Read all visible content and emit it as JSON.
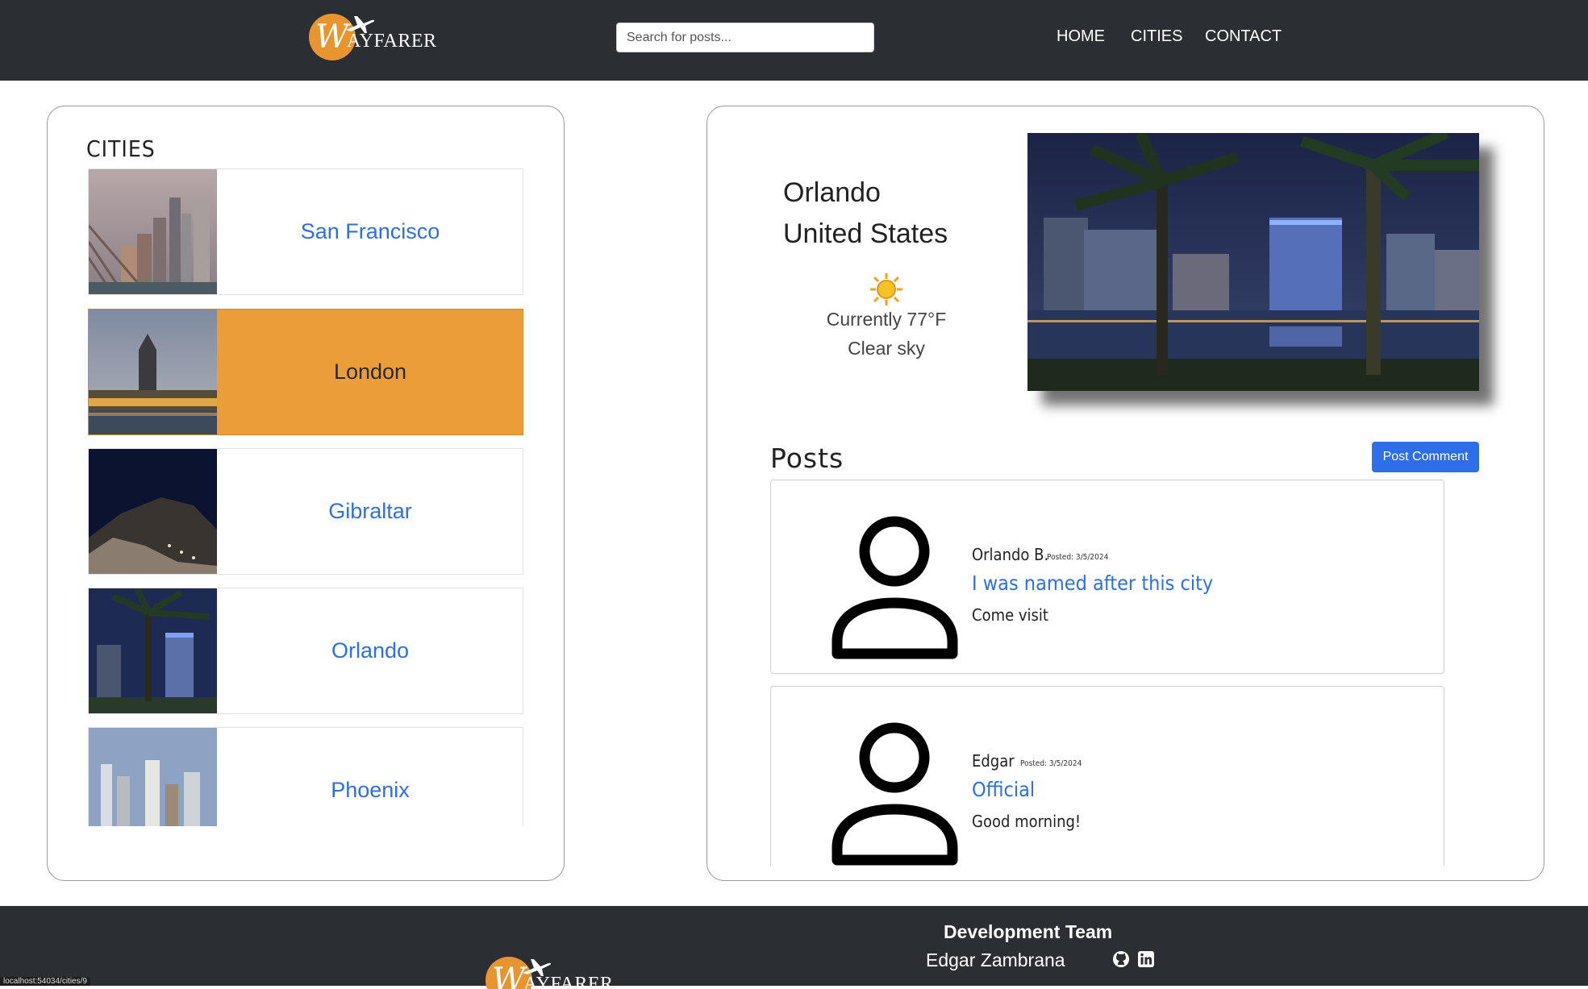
{
  "brand": {
    "logo_letter": "W",
    "logo_word": "AYFARER",
    "accent": "#e9952f"
  },
  "search": {
    "placeholder": "Search for posts..."
  },
  "nav": {
    "home": "HOME",
    "cities": "CITIES",
    "contact": "CONTACT"
  },
  "sidebar": {
    "title": "CITIES",
    "cities": [
      {
        "name": "San Francisco",
        "selected": false
      },
      {
        "name": "London",
        "selected": true
      },
      {
        "name": "Gibraltar",
        "selected": false
      },
      {
        "name": "Orlando",
        "selected": false
      },
      {
        "name": "Phoenix",
        "selected": false
      }
    ]
  },
  "city_detail": {
    "city": "Orlando",
    "country": "United States",
    "weather_icon": "sun-icon",
    "temperature": "Currently 77°F",
    "condition": "Clear sky"
  },
  "posts": {
    "title": "Posts",
    "post_button": "Post Comment",
    "items": [
      {
        "author": "Orlando B.",
        "date": "Posted: 3/5/2024",
        "title": "I was named after this city",
        "body": "Come visit"
      },
      {
        "author": "Edgar",
        "date": "Posted: 3/5/2024",
        "title": "Official",
        "body": "Good morning!"
      }
    ]
  },
  "footer": {
    "dev_title": "Development Team",
    "members": [
      "Edgar Zambrana"
    ]
  },
  "status_bar": {
    "url": "localhost:54034/cities/9"
  },
  "colors": {
    "navbar": "#2b2f33",
    "link_blue": "#2c6fe6",
    "selected_orange": "#eb9d3a",
    "button_blue": "#2e6ee8"
  }
}
